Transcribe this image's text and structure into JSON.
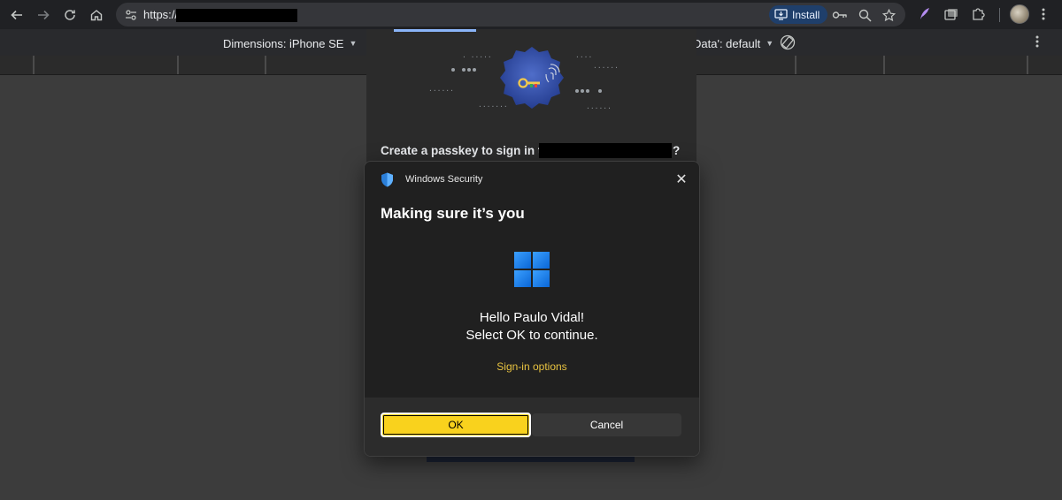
{
  "browser": {
    "url_prefix": "https://",
    "install_label": "Install"
  },
  "device_toolbar": {
    "dimensions_label": "Dimensions:",
    "device": "iPhone SE",
    "data_label": "Data': default"
  },
  "passkey": {
    "title_prefix": "Create a passkey to sign in to",
    "title_suffix": "?"
  },
  "dialog": {
    "app_name": "Windows Security",
    "heading": "Making sure it’s you",
    "greeting": "Hello Paulo Vidal!",
    "instruction": "Select OK to continue.",
    "signin_options": "Sign-in options",
    "ok_label": "OK",
    "cancel_label": "Cancel"
  },
  "colors": {
    "ok_button": "#f9d21d",
    "link": "#e8c340",
    "accent_blue": "#8ab4f8"
  }
}
